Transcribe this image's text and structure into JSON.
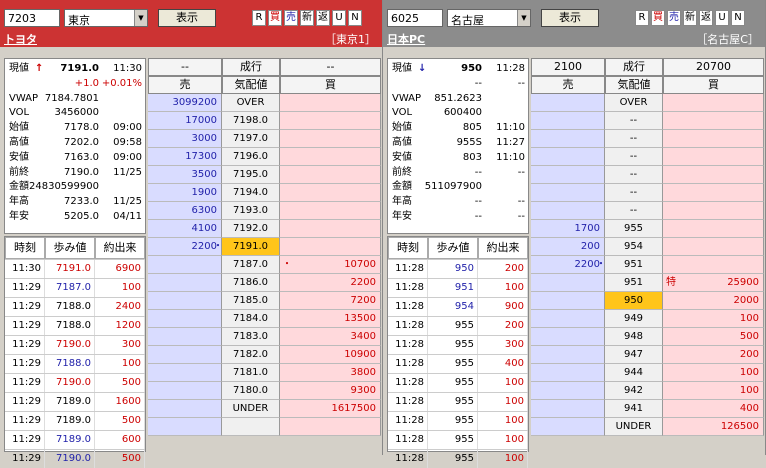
{
  "panels": [
    {
      "code": "7203",
      "market": "東京",
      "show_btn": "表示",
      "mini": [
        "R",
        "買",
        "売",
        "新",
        "返",
        "U",
        "N"
      ],
      "name": "トヨタ",
      "market_label": "［東京1］",
      "info": [
        {
          "l": "現値",
          "v": "7191.0",
          "t": "11:30",
          "arrow": "↑",
          "arrow_color": "#cc0000"
        },
        {
          "l": "",
          "v": "+1.0",
          "t": "+0.01%",
          "color": "#cc0000"
        },
        {
          "l": "VWAP",
          "v": "7184.7801",
          "t": ""
        },
        {
          "l": "VOL",
          "v": "3456000",
          "t": ""
        },
        {
          "l": "始値",
          "v": "7178.0",
          "t": "09:00"
        },
        {
          "l": "高値",
          "v": "7202.0",
          "t": "09:58"
        },
        {
          "l": "安値",
          "v": "7163.0",
          "t": "09:00"
        },
        {
          "l": "前終",
          "v": "7190.0",
          "t": "11/25"
        },
        {
          "l": "金額",
          "v": "24830599900",
          "t": ""
        },
        {
          "l": "年高",
          "v": "7233.0",
          "t": "11/25"
        },
        {
          "l": "年安",
          "v": "5205.0",
          "t": "04/11"
        }
      ],
      "trade_head": [
        "時刻",
        "歩み値",
        "約出来"
      ],
      "trades": [
        {
          "t": "11:30",
          "p": "7191.0",
          "v": "6900",
          "pc": "#cc0000",
          "vc": "#cc0000"
        },
        {
          "t": "11:29",
          "p": "7187.0",
          "v": "100",
          "pc": "#2222aa",
          "vc": "#cc0000"
        },
        {
          "t": "11:29",
          "p": "7188.0",
          "v": "2400",
          "pc": "#000",
          "vc": "#cc0000"
        },
        {
          "t": "11:29",
          "p": "7188.0",
          "v": "1200",
          "pc": "#000",
          "vc": "#cc0000"
        },
        {
          "t": "11:29",
          "p": "7190.0",
          "v": "300",
          "pc": "#cc0000",
          "vc": "#cc0000"
        },
        {
          "t": "11:29",
          "p": "7188.0",
          "v": "100",
          "pc": "#2222aa",
          "vc": "#cc0000"
        },
        {
          "t": "11:29",
          "p": "7190.0",
          "v": "500",
          "pc": "#cc0000",
          "vc": "#cc0000"
        },
        {
          "t": "11:29",
          "p": "7189.0",
          "v": "1600",
          "pc": "#000",
          "vc": "#cc0000"
        },
        {
          "t": "11:29",
          "p": "7189.0",
          "v": "500",
          "pc": "#000",
          "vc": "#cc0000"
        },
        {
          "t": "11:29",
          "p": "7189.0",
          "v": "600",
          "pc": "#2222aa",
          "vc": "#cc0000"
        },
        {
          "t": "11:29",
          "p": "7190.0",
          "v": "500",
          "pc": "#2222aa",
          "vc": "#cc0000"
        }
      ],
      "board_head": [
        "--",
        "成行",
        "--"
      ],
      "board_sub": [
        "売",
        "気配値",
        "買"
      ],
      "board": [
        {
          "s": "3099200",
          "p": "OVER",
          "b": ""
        },
        {
          "s": "17000",
          "p": "7198.0",
          "b": ""
        },
        {
          "s": "3000",
          "p": "7197.0",
          "b": ""
        },
        {
          "s": "17300",
          "p": "7196.0",
          "b": ""
        },
        {
          "s": "3500",
          "p": "7195.0",
          "b": ""
        },
        {
          "s": "1900",
          "p": "7194.0",
          "b": ""
        },
        {
          "s": "6300",
          "p": "7193.0",
          "b": ""
        },
        {
          "s": "4100",
          "p": "7192.0",
          "b": ""
        },
        {
          "s": "2200",
          "p": "7191.0",
          "b": "",
          "hl": true,
          "sm": "・"
        },
        {
          "s": "",
          "p": "7187.0",
          "b": "10700",
          "bm": "・"
        },
        {
          "s": "",
          "p": "7186.0",
          "b": "2200"
        },
        {
          "s": "",
          "p": "7185.0",
          "b": "7200"
        },
        {
          "s": "",
          "p": "7184.0",
          "b": "13500"
        },
        {
          "s": "",
          "p": "7183.0",
          "b": "3400"
        },
        {
          "s": "",
          "p": "7182.0",
          "b": "10900"
        },
        {
          "s": "",
          "p": "7181.0",
          "b": "3800"
        },
        {
          "s": "",
          "p": "7180.0",
          "b": "9300"
        },
        {
          "s": "",
          "p": "UNDER",
          "b": "1617500"
        },
        {
          "s": "",
          "p": "",
          "b": ""
        }
      ]
    },
    {
      "code": "6025",
      "market": "名古屋",
      "show_btn": "表示",
      "mini": [
        "R",
        "買",
        "売",
        "新",
        "返",
        "U",
        "N"
      ],
      "name": "日本PC",
      "market_label": "［名古屋C］",
      "info": [
        {
          "l": "現値",
          "v": "950",
          "t": "11:28",
          "arrow": "↓",
          "arrow_color": "#2222aa"
        },
        {
          "l": "",
          "v": "--",
          "t": "--"
        },
        {
          "l": "VWAP",
          "v": "851.2623",
          "t": ""
        },
        {
          "l": "VOL",
          "v": "600400",
          "t": ""
        },
        {
          "l": "始値",
          "v": "805",
          "t": "11:10"
        },
        {
          "l": "高値",
          "v": "955S",
          "t": "11:27"
        },
        {
          "l": "安値",
          "v": "803",
          "t": "11:10"
        },
        {
          "l": "前終",
          "v": "--",
          "t": "--"
        },
        {
          "l": "金額",
          "v": "511097900",
          "t": ""
        },
        {
          "l": "年高",
          "v": "--",
          "t": "--"
        },
        {
          "l": "年安",
          "v": "--",
          "t": "--"
        }
      ],
      "trade_head": [
        "時刻",
        "歩み値",
        "約出来"
      ],
      "trades": [
        {
          "t": "11:28",
          "p": "950",
          "v": "200",
          "pc": "#2222aa",
          "vc": "#cc0000"
        },
        {
          "t": "11:28",
          "p": "951",
          "v": "100",
          "pc": "#2222aa",
          "vc": "#cc0000"
        },
        {
          "t": "11:28",
          "p": "954",
          "v": "900",
          "pc": "#2222aa",
          "vc": "#cc0000"
        },
        {
          "t": "11:28",
          "p": "955",
          "v": "200",
          "pc": "#000",
          "vc": "#cc0000"
        },
        {
          "t": "11:28",
          "p": "955",
          "v": "300",
          "pc": "#000",
          "vc": "#cc0000"
        },
        {
          "t": "11:28",
          "p": "955",
          "v": "400",
          "pc": "#000",
          "vc": "#cc0000"
        },
        {
          "t": "11:28",
          "p": "955",
          "v": "100",
          "pc": "#000",
          "vc": "#cc0000"
        },
        {
          "t": "11:28",
          "p": "955",
          "v": "100",
          "pc": "#000",
          "vc": "#cc0000"
        },
        {
          "t": "11:28",
          "p": "955",
          "v": "100",
          "pc": "#000",
          "vc": "#cc0000"
        },
        {
          "t": "11:28",
          "p": "955",
          "v": "100",
          "pc": "#000",
          "vc": "#cc0000"
        },
        {
          "t": "11:28",
          "p": "955",
          "v": "100",
          "pc": "#000",
          "vc": "#cc0000"
        }
      ],
      "board_head": [
        "2100",
        "成行",
        "20700"
      ],
      "board_sub": [
        "売",
        "気配値",
        "買"
      ],
      "board": [
        {
          "s": "",
          "p": "OVER",
          "b": ""
        },
        {
          "s": "",
          "p": "--",
          "b": ""
        },
        {
          "s": "",
          "p": "--",
          "b": ""
        },
        {
          "s": "",
          "p": "--",
          "b": ""
        },
        {
          "s": "",
          "p": "--",
          "b": ""
        },
        {
          "s": "",
          "p": "--",
          "b": ""
        },
        {
          "s": "",
          "p": "--",
          "b": ""
        },
        {
          "s": "1700",
          "p": "955",
          "b": ""
        },
        {
          "s": "200",
          "p": "954",
          "b": ""
        },
        {
          "s": "2200",
          "p": "951",
          "b": "",
          "sm": "・"
        },
        {
          "s": "",
          "p": "951",
          "b": "25900",
          "bt": "特"
        },
        {
          "s": "",
          "p": "950",
          "b": "2000",
          "hl": true
        },
        {
          "s": "",
          "p": "949",
          "b": "100"
        },
        {
          "s": "",
          "p": "948",
          "b": "500"
        },
        {
          "s": "",
          "p": "947",
          "b": "200"
        },
        {
          "s": "",
          "p": "944",
          "b": "100"
        },
        {
          "s": "",
          "p": "942",
          "b": "100"
        },
        {
          "s": "",
          "p": "941",
          "b": "400"
        },
        {
          "s": "",
          "p": "UNDER",
          "b": "126500"
        }
      ]
    }
  ]
}
